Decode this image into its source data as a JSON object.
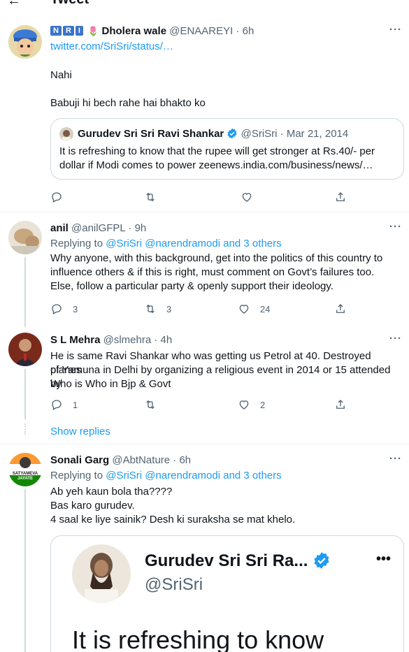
{
  "top": {
    "back": "←",
    "title": "Tweet"
  },
  "tweet1": {
    "badges": [
      "N",
      "R",
      "I"
    ],
    "flower": "🌷",
    "name": "Dholera wale",
    "handle": "@ENAAREYI",
    "dot": "·",
    "time": "6h",
    "link": "twitter.com/SriSri/status/…",
    "line1": "Nahi",
    "line2": "Babuji hi bech rahe hai bhakto ko",
    "quote": {
      "name": "Gurudev Sri Sri Ravi Shankar",
      "handle": "@SriSri",
      "dot": "·",
      "time": "Mar 21, 2014",
      "text1": "It is refreshing to know that the rupee will get stronger at Rs.40/- per",
      "text2": "dollar if Modi comes to power zeenews.india.com/business/news/…"
    }
  },
  "tweet2": {
    "name": "anil",
    "handle": "@anilGFPL",
    "dot": "·",
    "time": "9h",
    "replying": "Replying to",
    "mentions": "@SriSri @narendramodi and 3 others",
    "line1": "Why anyone, with this background, get into the politics of this country to",
    "line2": "influence others & if this is right, must comment on Govt’s failures too.",
    "line3": "Else, follow a particular party & openly support their ideology.",
    "replies": "3",
    "retweets": "3",
    "likes": "24"
  },
  "tweet3": {
    "name": "S L Mehra",
    "handle": "@slmehra",
    "dot": "·",
    "time": "4h",
    "line1": "He is same Ravi Shankar who was getting us Petrol at 40. Destroyed planes",
    "line2": "of Yamuna in Delhi by organizing a religious event in 2014 or 15 attended by",
    "line3": "Who  is Who in Bjp & Govt",
    "replies": "1",
    "likes": "2",
    "show_replies": "Show replies"
  },
  "tweet4": {
    "name": "Sonali Garg",
    "handle": "@AbtNature",
    "dot": "·",
    "time": "6h",
    "avatar_text1": "SATYAMEVA",
    "avatar_text2": "JAYATE",
    "replying": "Replying to",
    "mentions": "@SriSri @narendramodi and 3 others",
    "line1": "Ab yeh kaun bola tha????",
    "line2": "Bas karo gurudev.",
    "line3": "4 saal ke liye sainik? Desh ki suraksha se mat khelo.",
    "image": {
      "name": "Gurudev Sri Sri Ra...",
      "handle": "@SriSri",
      "more": "•••",
      "text": "It is refreshing to know"
    }
  },
  "more_icon": "···",
  "colors": {
    "accent": "#1d9bf0",
    "muted": "#536471",
    "text": "#0f1419",
    "border": "#cfd9de"
  }
}
